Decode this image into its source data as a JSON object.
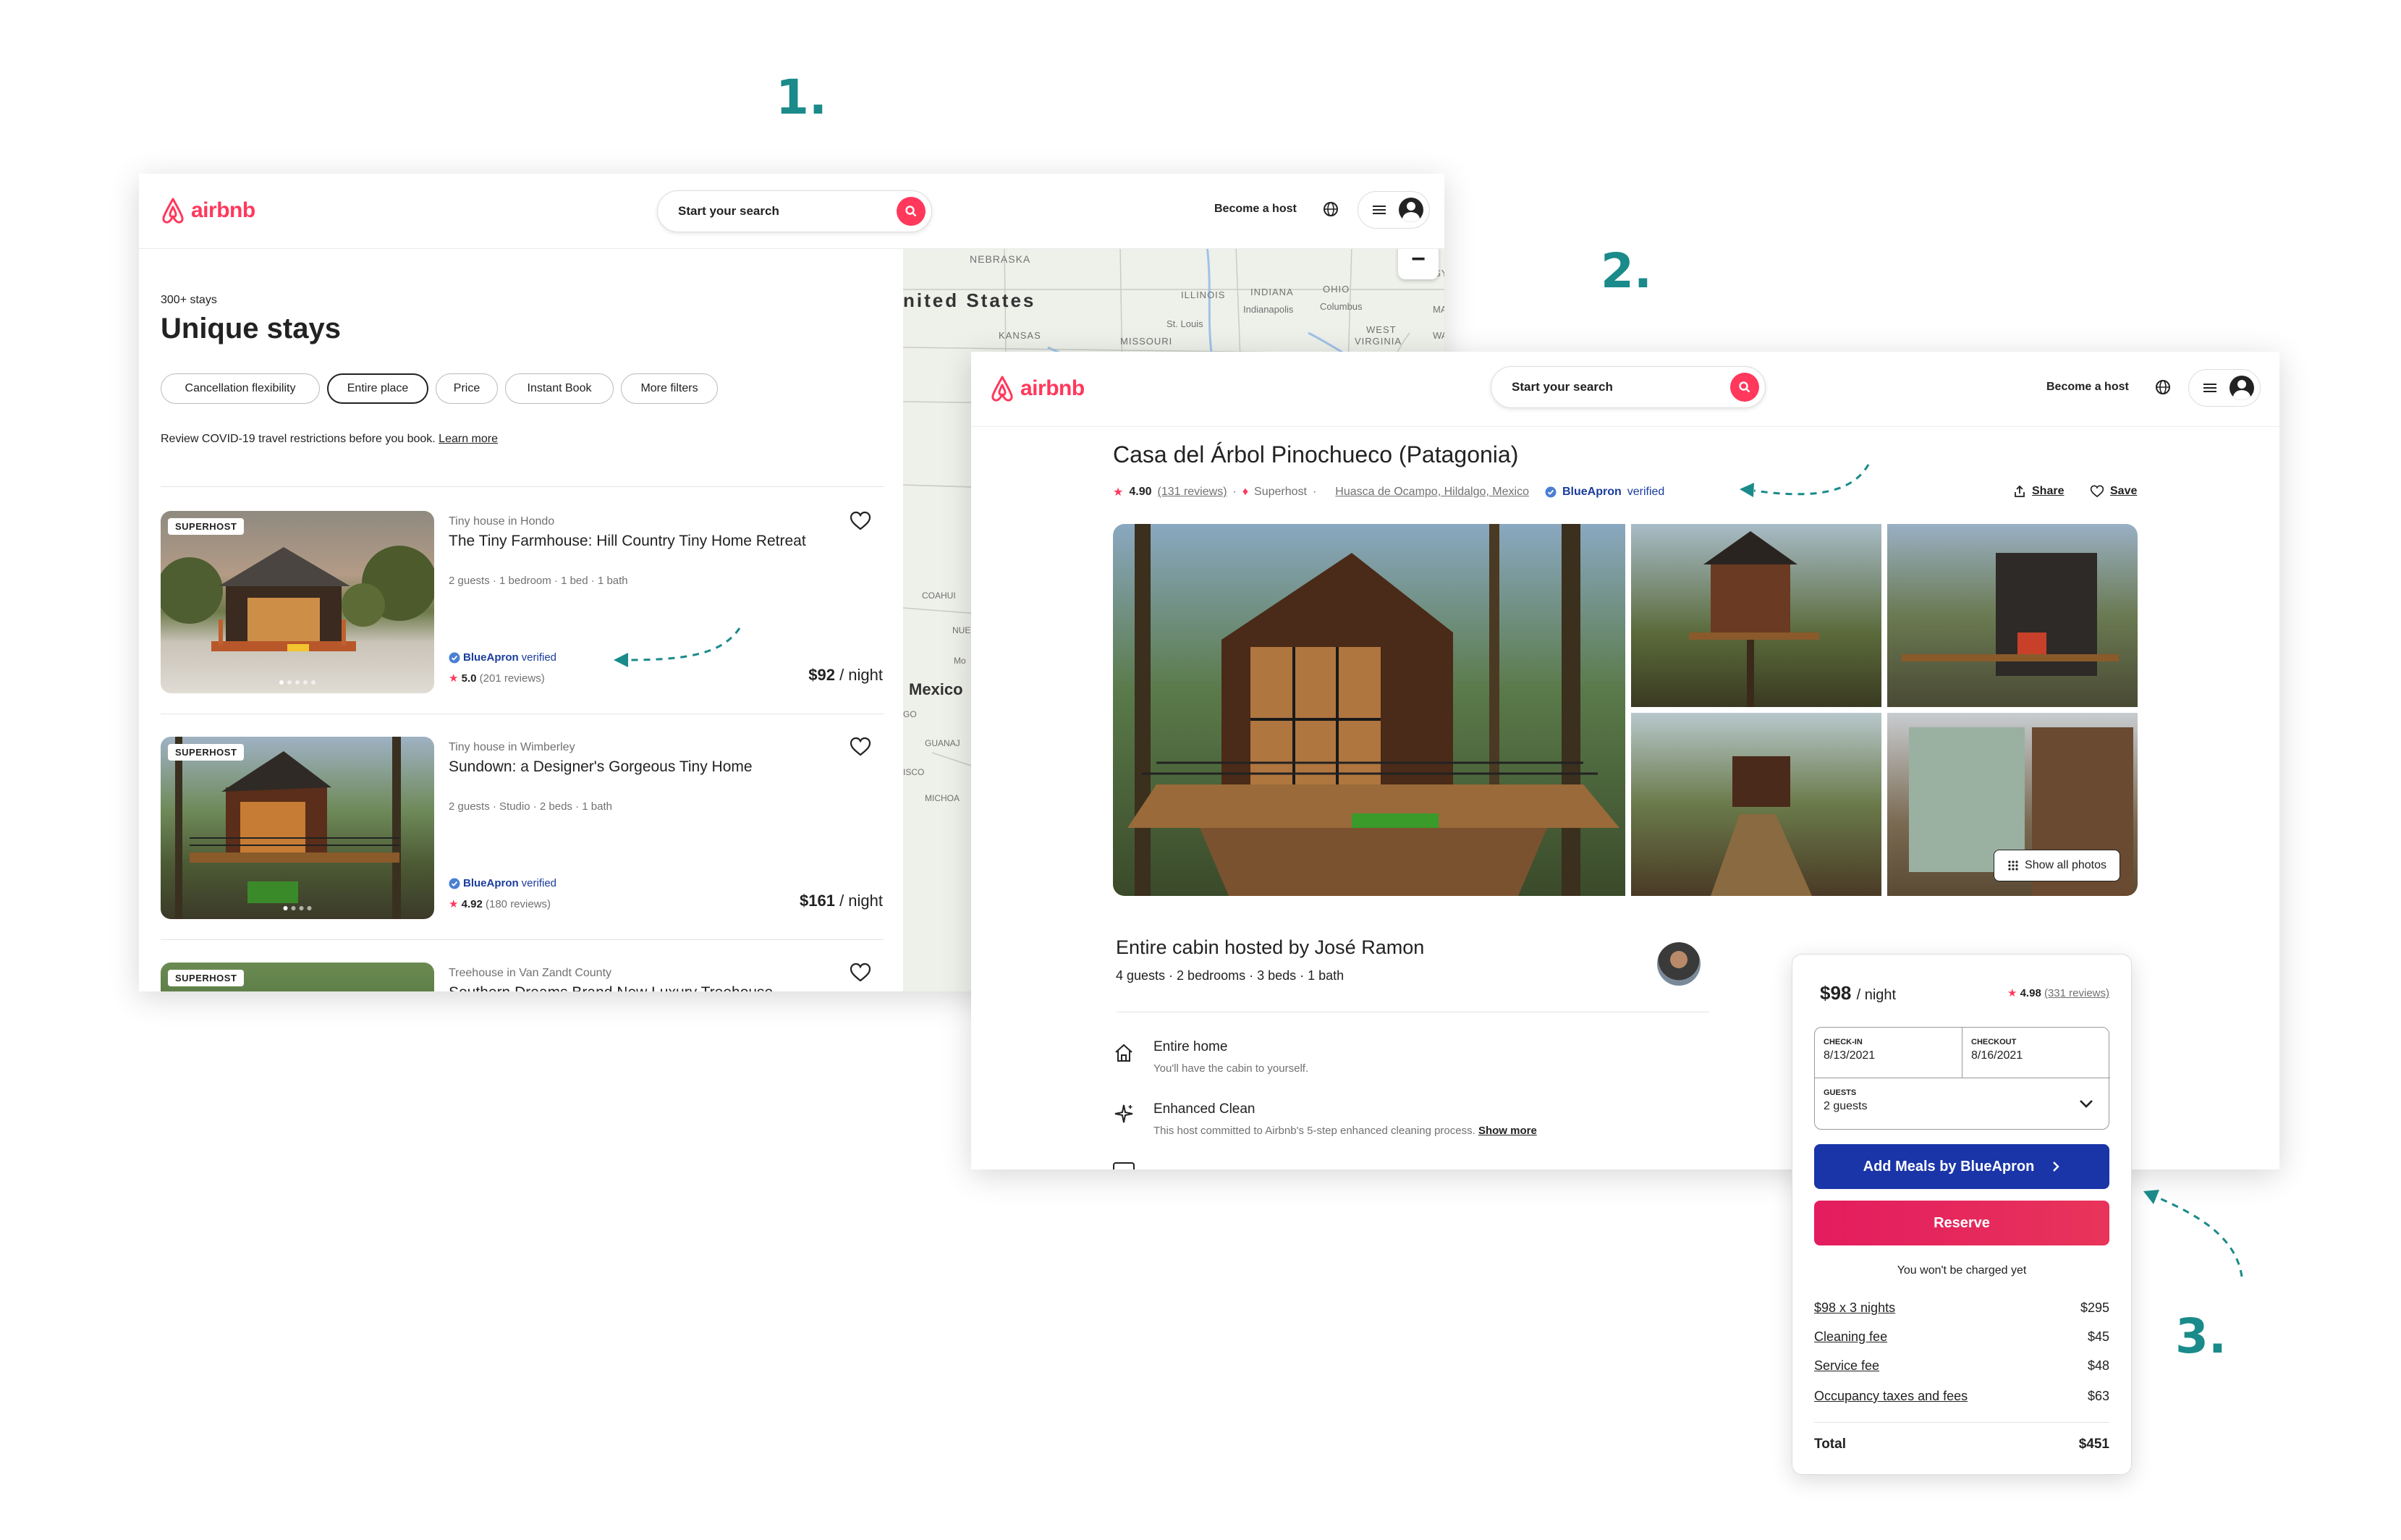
{
  "steps": {
    "one": "1.",
    "two": "2.",
    "three": "3."
  },
  "brand": {
    "name": "airbnb",
    "color": "#ff385c",
    "accent_blue": "#1a3c9c",
    "annotation": "#1a8a8a"
  },
  "header": {
    "search_placeholder": "Start your search",
    "become_host": "Become a host",
    "globe_icon": "globe-icon",
    "menu_icon": "hamburger-icon"
  },
  "listing_page": {
    "count": "300+ stays",
    "title": "Unique stays",
    "filters": [
      {
        "label": "Cancellation flexibility",
        "active": false
      },
      {
        "label": "Entire place",
        "active": true
      },
      {
        "label": "Price",
        "active": false
      },
      {
        "label": "Instant Book",
        "active": false
      },
      {
        "label": "More filters",
        "active": false
      }
    ],
    "covid_text": "Review COVID-19 travel restrictions before you book.",
    "learn_more": "Learn more",
    "listings": [
      {
        "badge": "SUPERHOST",
        "type": "Tiny house in Hondo",
        "title": "The Tiny Farmhouse: Hill Country Tiny Home Retreat",
        "details": "2 guests · 1 bedroom · 1 bed · 1 bath",
        "verified_brand": "BlueApron",
        "verified_word": "verified",
        "rating": "5.0",
        "reviews": "(201 reviews)",
        "price": "$92",
        "per_night": "/ night"
      },
      {
        "badge": "SUPERHOST",
        "type": "Tiny house in Wimberley",
        "title": "Sundown: a Designer's Gorgeous Tiny Home",
        "details": "2 guests · Studio · 2 beds · 1 bath",
        "verified_brand": "BlueApron",
        "verified_word": "verified",
        "rating": "4.92",
        "reviews": "(180 reviews)",
        "price": "$161",
        "per_night": "/ night"
      },
      {
        "badge": "SUPERHOST",
        "type": "Treehouse in Van Zandt County",
        "title": "Southern Dreams Brand New Luxury Treehouse"
      }
    ],
    "map": {
      "labels": [
        "NEBRASKA",
        "nited States",
        "ILLINOIS",
        "INDIANA",
        "OHIO",
        "Indianapolis",
        "Columbus",
        "KANSAS",
        "St. Louis",
        "MISSOURI",
        "WEST",
        "VIRGINIA",
        "PENNSY",
        "MA",
        "WA",
        "Mexico",
        "COAHUI",
        "NUE",
        "Mo",
        "GUANAJ",
        "MICHOA",
        "ISCO",
        "GO"
      ],
      "zoom_out": "−"
    }
  },
  "detail_page": {
    "title": "Casa del Árbol Pinochueco (Patagonia)",
    "rating": "4.90",
    "reviews": "(131 reviews)",
    "superhost": "Superhost",
    "location": "Huasca de Ocampo, Hildalgo, Mexico",
    "verified_brand": "BlueApron",
    "verified_word": "verified",
    "share": "Share",
    "save": "Save",
    "show_all_photos": "Show all photos",
    "host_title": "Entire cabin hosted by José Ramon",
    "host_details": "4 guests · 2 bedrooms · 3 beds · 1 bath",
    "features": [
      {
        "icon": "home-icon",
        "title": "Entire home",
        "desc": "You'll have the cabin to yourself.",
        "link": ""
      },
      {
        "icon": "sparkle-icon",
        "title": "Enhanced Clean",
        "desc": "This host committed to Airbnb's 5-step enhanced cleaning process.",
        "link": "Show more"
      }
    ]
  },
  "booking": {
    "price": "$98",
    "per_night": "/ night",
    "rating": "4.98",
    "reviews": "(331 reviews)",
    "checkin_label": "CHECK-IN",
    "checkin": "8/13/2021",
    "checkout_label": "CHECKOUT",
    "checkout": "8/16/2021",
    "guests_label": "GUESTS",
    "guests": "2 guests",
    "meals_button": "Add Meals by BlueApron",
    "reserve_button": "Reserve",
    "charge_note": "You won't be charged yet",
    "lines": [
      {
        "label": "$98 x 3 nights",
        "amount": "$295"
      },
      {
        "label": "Cleaning fee",
        "amount": "$45"
      },
      {
        "label": "Service fee",
        "amount": "$48"
      },
      {
        "label": "Occupancy taxes and fees",
        "amount": "$63"
      }
    ],
    "total_label": "Total",
    "total": "$451"
  }
}
